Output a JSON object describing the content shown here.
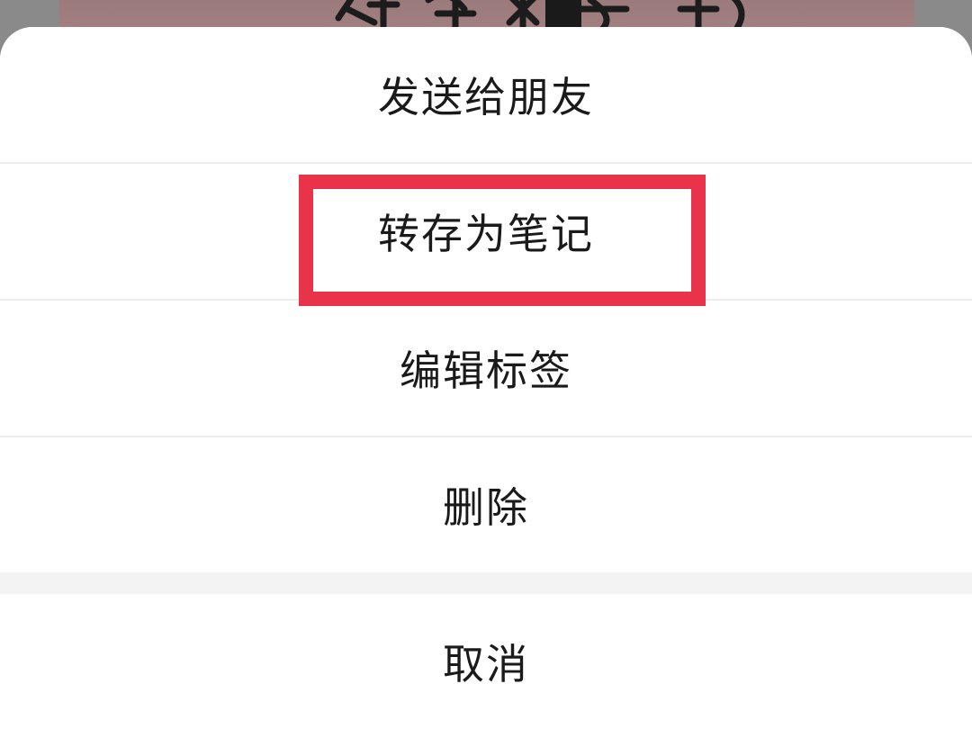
{
  "action_sheet": {
    "items": [
      {
        "label": "发送给朋友"
      },
      {
        "label": "转存为笔记"
      },
      {
        "label": "编辑标签"
      },
      {
        "label": "删除"
      }
    ],
    "cancel_label": "取消"
  },
  "colors": {
    "highlight_border": "#e8334a",
    "sheet_background": "#ffffff",
    "separator": "#ececec",
    "gap_background": "#f3f3f3",
    "text": "#1a1a1a"
  }
}
